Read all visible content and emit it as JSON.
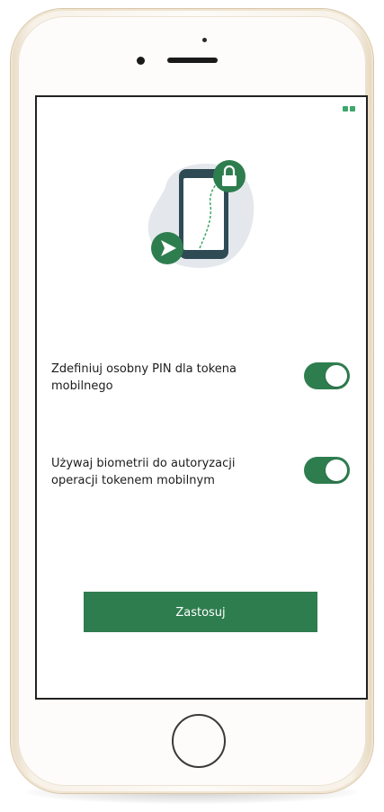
{
  "settings": {
    "separate_pin": {
      "label": "Zdefiniuj osobny PIN dla tokena mobilnego",
      "enabled": true
    },
    "biometrics": {
      "label": "Używaj biometrii do autoryzacji operacji tokenem mobilnym",
      "enabled": true
    }
  },
  "apply_button": {
    "label": "Zastosuj"
  },
  "colors": {
    "accent": "#2e7d4f",
    "illustration_blob": "#e4e8ec",
    "phone_frame": "#2e4a55"
  },
  "icons": {
    "illustration": "phone-with-lock-and-send-icon",
    "lock": "lock-icon",
    "send": "send-arrow-icon",
    "battery": "battery-icon"
  }
}
